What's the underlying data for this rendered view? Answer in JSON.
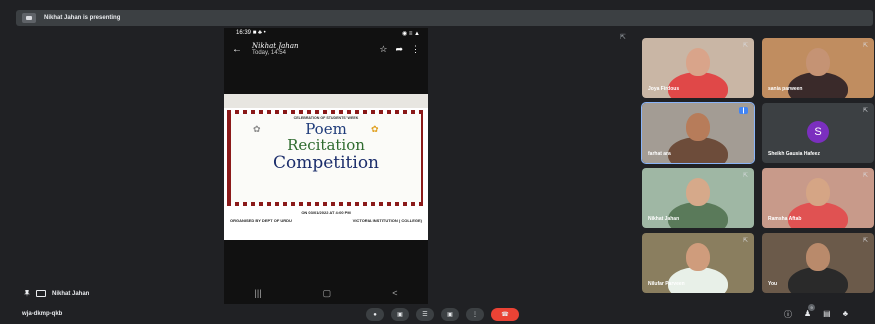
{
  "topbar": {
    "presenting_text": "Nikhat Jahan is presenting"
  },
  "phone": {
    "status_time": "16:39",
    "status_icons": "■ ♣ •",
    "status_right": "◉ ≡ ▲",
    "back": "←",
    "contact_name": "Nikhat Jahan",
    "contact_time": "Today, 14:54",
    "star": "☆",
    "share": "➦",
    "more": "⋮",
    "poster": {
      "heading": "CELEBRATION OF STUDENTS' WEEK",
      "line1": "Poem",
      "line2": "Recitation",
      "line3": "Competition",
      "date": "ON 03/01/2022 AT 4:00 PM",
      "org_left": "ORGANISED BY DEPT OF URDU",
      "org_right": "VICTORIA INSTITUTION ( COLLEGE)"
    },
    "nav": [
      "|||",
      "▢",
      "<"
    ]
  },
  "participants": [
    {
      "name": "Joya Firdous",
      "skin": "#d9a48a",
      "cloth": "#e04848",
      "bg": "#c9b6a5"
    },
    {
      "name": "sania parween",
      "skin": "#c59374",
      "cloth": "#3a2a2a",
      "bg": "#c08d60"
    },
    {
      "name": "farhat ara",
      "skin": "#b77c5a",
      "cloth": "#6d4c3a",
      "bg": "#a39c94",
      "active": true
    },
    {
      "name": "Sheikh Gausia Hafeez",
      "avatar_letter": "S",
      "avatar_color": "#7b2fbf"
    },
    {
      "name": "Nikhat Jahan",
      "skin": "#d6a98a",
      "cloth": "#5a7a5a",
      "bg": "#9fb7a4"
    },
    {
      "name": "Ramsha Aftab",
      "skin": "#d5a585",
      "cloth": "#e05252",
      "bg": "#c89a8a"
    },
    {
      "name": "Nilufar Parveen",
      "skin": "#cf9c7c",
      "cloth": "#e8f0e8",
      "bg": "#8a7e5f"
    },
    {
      "name": "You",
      "skin": "#b98a6b",
      "cloth": "#2a2a2a",
      "bg": "#6b5a4a"
    }
  ],
  "presenter_label": "Nikhat Jahan",
  "meeting_code": "wja-dkmp-qkb",
  "controls": [
    "●",
    "▣",
    "☰",
    "▣",
    "⋮",
    "☎"
  ],
  "right_controls": [
    "ⓘ",
    "♟",
    "▤",
    "♣"
  ],
  "participant_count": "9",
  "colors": {
    "accent": "#8ab4f8",
    "end_call": "#ea4335"
  }
}
